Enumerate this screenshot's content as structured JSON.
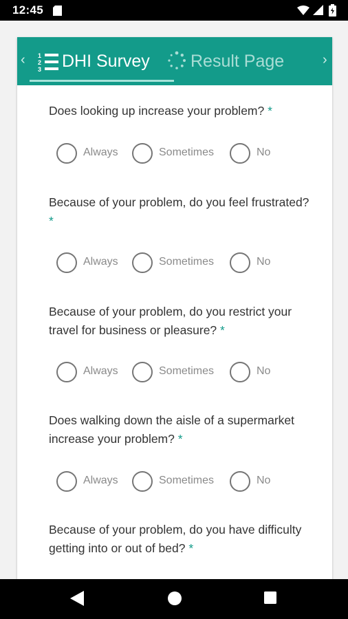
{
  "status_bar": {
    "time": "12:45",
    "icons": [
      "sd-card-icon",
      "wifi-icon",
      "cell-signal-icon",
      "battery-icon"
    ]
  },
  "tabs": {
    "prev_arrow": "‹",
    "next_arrow": "›",
    "items": [
      {
        "label": "DHI Survey",
        "icon": "list-numbered-icon",
        "selected": true
      },
      {
        "label": "Result Page",
        "icon": "loading-dots-icon",
        "selected": false
      }
    ]
  },
  "questions": [
    {
      "text": "Does looking up increase your problem?",
      "required_mark": "*"
    },
    {
      "text": "Because of your problem, do you feel frustrated?",
      "required_mark": "*"
    },
    {
      "text": "Because of your problem, do you restrict your travel for business or pleasure?",
      "required_mark": "*"
    },
    {
      "text": "Does walking down the aisle of a supermarket increase your problem?",
      "required_mark": "*"
    },
    {
      "text": "Because of your problem, do you have difficulty getting into or out of bed?",
      "required_mark": "*"
    }
  ],
  "options": [
    "Always",
    "Sometimes",
    "No"
  ],
  "colors": {
    "accent": "#139b8a",
    "tab_indicator": "#a7e3d9",
    "radio_border": "#757575",
    "option_text": "#8a8a8a"
  },
  "nav_bar": {
    "icons": [
      "back-icon",
      "home-icon",
      "recents-icon"
    ]
  }
}
